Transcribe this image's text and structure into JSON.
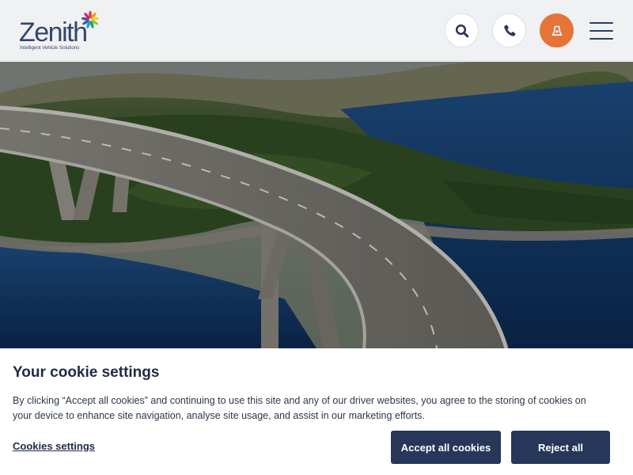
{
  "brand": {
    "name": "Zenith",
    "tagline": "Intelligent Vehicle Solutions",
    "logo_petal_colors": [
      "#e63b2e",
      "#f29a1f",
      "#f7d31d",
      "#8cc63e",
      "#1fa463",
      "#19a2c8",
      "#2b64b3",
      "#6a3d9a",
      "#c2277f"
    ]
  },
  "header": {
    "search_icon": "search-icon",
    "phone_icon": "phone-icon",
    "driver_icon": "driver-login-icon",
    "menu_icon": "hamburger-menu-icon"
  },
  "hero": {
    "image": "curved-bridge-over-loch"
  },
  "cookie_banner": {
    "title": "Your cookie settings",
    "body": "By clicking “Accept all cookies” and continuing to use this site and any of our driver websites, you agree to the storing of cookies on your device to enhance site navigation, analyse site usage, and assist in our marketing efforts.",
    "settings_link": "Cookies settings",
    "accept_label": "Accept all cookies",
    "reject_label": "Reject all"
  },
  "colors": {
    "header_bg": "#f0f1f2",
    "brand_navy": "#27375a",
    "accent_orange": "#e67439"
  }
}
